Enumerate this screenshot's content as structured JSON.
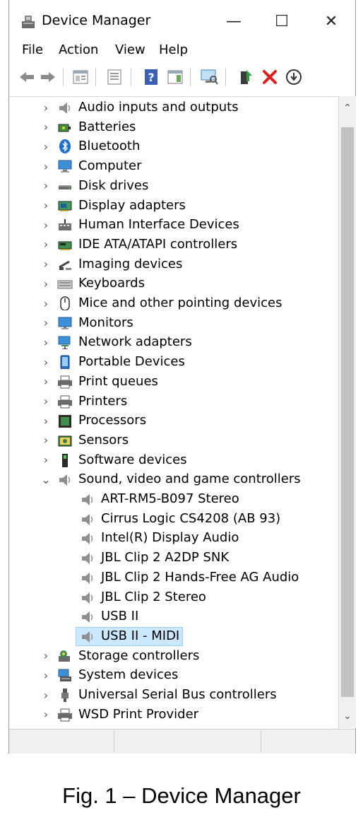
{
  "window": {
    "title": "Device Manager",
    "controls": {
      "minimize": "—",
      "maximize": "☐",
      "close": "✕"
    }
  },
  "menu": [
    "File",
    "Action",
    "View",
    "Help"
  ],
  "toolbar": [
    "back-icon",
    "forward-icon",
    "properties-icon",
    "show-hidden-icon",
    "help-icon",
    "action-pane-icon",
    "scan-hardware-icon",
    "update-driver-icon",
    "uninstall-icon",
    "disable-icon"
  ],
  "colors": {
    "selection": "#cce8ff",
    "selection_border": "#99d1ff",
    "uninstall_red": "#e02020"
  },
  "tree": {
    "categories_before": [
      {
        "label": "Audio inputs and outputs",
        "icon": "speaker-icon"
      },
      {
        "label": "Batteries",
        "icon": "battery-icon"
      },
      {
        "label": "Bluetooth",
        "icon": "bluetooth-icon"
      },
      {
        "label": "Computer",
        "icon": "computer-icon"
      },
      {
        "label": "Disk drives",
        "icon": "disk-drive-icon"
      },
      {
        "label": "Display adapters",
        "icon": "display-adapter-icon"
      },
      {
        "label": "Human Interface Devices",
        "icon": "hid-icon"
      },
      {
        "label": "IDE ATA/ATAPI controllers",
        "icon": "ide-controller-icon"
      },
      {
        "label": "Imaging devices",
        "icon": "camera-icon"
      },
      {
        "label": "Keyboards",
        "icon": "keyboard-icon"
      },
      {
        "label": "Mice and other pointing devices",
        "icon": "mouse-icon"
      },
      {
        "label": "Monitors",
        "icon": "monitor-icon"
      },
      {
        "label": "Network adapters",
        "icon": "network-adapter-icon"
      },
      {
        "label": "Portable Devices",
        "icon": "portable-device-icon"
      },
      {
        "label": "Print queues",
        "icon": "printer-icon"
      },
      {
        "label": "Printers",
        "icon": "printer-icon"
      },
      {
        "label": "Processors",
        "icon": "processor-icon"
      },
      {
        "label": "Sensors",
        "icon": "sensor-icon"
      },
      {
        "label": "Software devices",
        "icon": "software-device-icon"
      }
    ],
    "expanded": {
      "label": "Sound, video and game controllers",
      "icon": "speaker-icon",
      "children": [
        {
          "label": "ART-RM5-B097 Stereo",
          "selected": false
        },
        {
          "label": "Cirrus Logic CS4208 (AB 93)",
          "selected": false
        },
        {
          "label": "Intel(R) Display Audio",
          "selected": false
        },
        {
          "label": "JBL Clip 2 A2DP SNK",
          "selected": false
        },
        {
          "label": "JBL Clip 2 Hands-Free AG Audio",
          "selected": false
        },
        {
          "label": "JBL Clip 2 Stereo",
          "selected": false
        },
        {
          "label": "USB II",
          "selected": false
        },
        {
          "label": "USB II - MIDI",
          "selected": true
        }
      ]
    },
    "categories_after": [
      {
        "label": "Storage controllers",
        "icon": "storage-controller-icon"
      },
      {
        "label": "System devices",
        "icon": "system-device-icon"
      },
      {
        "label": "Universal Serial Bus controllers",
        "icon": "usb-icon"
      },
      {
        "label": "WSD Print Provider",
        "icon": "printer-icon"
      }
    ]
  },
  "caption": "Fig. 1 – Device Manager"
}
